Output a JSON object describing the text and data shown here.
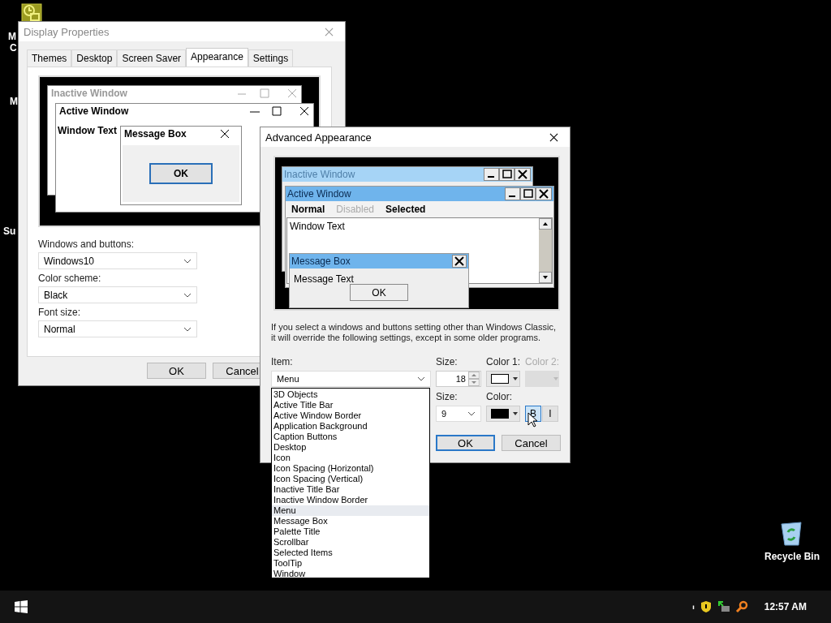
{
  "desktop": {
    "icon_labels": [
      {
        "text": "M"
      },
      {
        "text": "C"
      },
      {
        "text": "M"
      },
      {
        "text": "Su"
      }
    ],
    "recycle_bin": "Recycle Bin"
  },
  "display_properties": {
    "title": "Display Properties",
    "tabs": [
      {
        "label": "Themes",
        "selected": false
      },
      {
        "label": "Desktop",
        "selected": false
      },
      {
        "label": "Screen Saver",
        "selected": false
      },
      {
        "label": "Appearance",
        "selected": true
      },
      {
        "label": "Settings",
        "selected": false
      }
    ],
    "preview": {
      "inactive_title": "Inactive Window",
      "active_title": "Active Window",
      "window_text": "Window Text",
      "message_box_title": "Message Box",
      "ok": "OK"
    },
    "fields": [
      {
        "label": "Windows and buttons:",
        "value": "Windows10"
      },
      {
        "label": "Color scheme:",
        "value": "Black"
      },
      {
        "label": "Font size:",
        "value": "Normal"
      }
    ],
    "buttons": [
      "OK",
      "Cancel"
    ]
  },
  "advanced": {
    "title": "Advanced Appearance",
    "preview": {
      "inactive_title": "Inactive Window",
      "active_title": "Active Window",
      "menu": [
        {
          "label": "Normal",
          "kind": "normal"
        },
        {
          "label": "Disabled",
          "kind": "disabled"
        },
        {
          "label": "Selected",
          "kind": "selected"
        }
      ],
      "window_text": "Window Text",
      "message_box_title": "Message Box",
      "message_text": "Message Text",
      "ok": "OK"
    },
    "note": "If you select a windows and buttons setting other than Windows Classic, it will override the following settings, except in some older programs.",
    "item": {
      "label": "Item:",
      "value": "Menu"
    },
    "item_list": [
      {
        "label": "3D Objects",
        "selected": false
      },
      {
        "label": "Active Title Bar",
        "selected": false
      },
      {
        "label": "Active Window Border",
        "selected": false
      },
      {
        "label": "Application Background",
        "selected": false
      },
      {
        "label": "Caption Buttons",
        "selected": false
      },
      {
        "label": "Desktop",
        "selected": false
      },
      {
        "label": "Icon",
        "selected": false
      },
      {
        "label": "Icon Spacing (Horizontal)",
        "selected": false
      },
      {
        "label": "Icon Spacing (Vertical)",
        "selected": false
      },
      {
        "label": "Inactive Title Bar",
        "selected": false
      },
      {
        "label": "Inactive Window Border",
        "selected": false
      },
      {
        "label": "Menu",
        "selected": true
      },
      {
        "label": "Message Box",
        "selected": false
      },
      {
        "label": "Palette Title",
        "selected": false
      },
      {
        "label": "Scrollbar",
        "selected": false
      },
      {
        "label": "Selected Items",
        "selected": false
      },
      {
        "label": "ToolTip",
        "selected": false
      },
      {
        "label": "Window",
        "selected": false
      }
    ],
    "size": {
      "label": "Size:",
      "value": "18"
    },
    "color1": {
      "label": "Color 1:",
      "color": "#ffffff"
    },
    "color2": {
      "label": "Color 2:",
      "disabled": true
    },
    "font_size": {
      "label": "Size:",
      "value": "9"
    },
    "font_color": {
      "label": "Color:",
      "color": "#000000"
    },
    "bold": {
      "label": "B",
      "on": true
    },
    "italic": {
      "label": "I",
      "on": false
    },
    "buttons": [
      "OK",
      "Cancel"
    ]
  },
  "taskbar": {
    "clock": "12:57 AM"
  }
}
